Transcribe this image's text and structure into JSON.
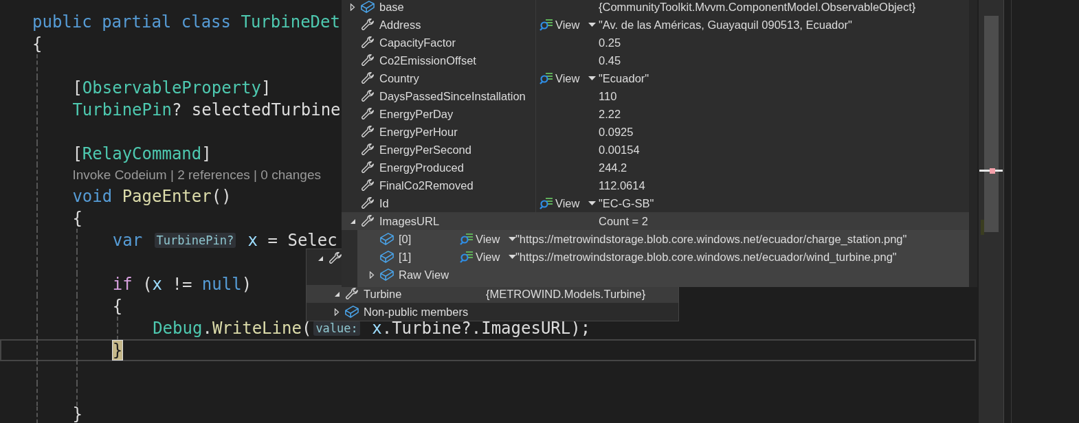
{
  "editor": {
    "lines": [
      {
        "kind": "code",
        "current": false,
        "tokens": [
          {
            "text": "public partial class ",
            "kind": "keyword"
          },
          {
            "text": "TurbineDet",
            "kind": "type"
          }
        ]
      },
      {
        "kind": "code",
        "current": false,
        "tokens": [
          {
            "text": "{",
            "kind": "plain"
          }
        ],
        "children": [
          {
            "kind": "blank",
            "current": false
          },
          {
            "kind": "code",
            "current": false,
            "tokens": [
              {
                "text": "[",
                "kind": "plain"
              },
              {
                "text": "ObservableProperty",
                "kind": "type"
              },
              {
                "text": "]",
                "kind": "plain"
              }
            ]
          },
          {
            "kind": "code",
            "current": false,
            "tokens": [
              {
                "text": "TurbinePin",
                "kind": "type"
              },
              {
                "text": "? selectedTurbine",
                "kind": "plain"
              }
            ]
          },
          {
            "kind": "blank",
            "current": false
          },
          {
            "kind": "code",
            "current": false,
            "tokens": [
              {
                "text": "[",
                "kind": "plain"
              },
              {
                "text": "RelayCommand",
                "kind": "type"
              },
              {
                "text": "]",
                "kind": "plain"
              }
            ]
          },
          {
            "kind": "codelens",
            "current": false,
            "text": "Invoke Codeium | 2 references | 0 changes"
          },
          {
            "kind": "code",
            "current": false,
            "tokens": [
              {
                "text": "void ",
                "kind": "keyword"
              },
              {
                "text": "PageEnter",
                "kind": "method"
              },
              {
                "text": "()",
                "kind": "plain"
              }
            ]
          },
          {
            "kind": "code",
            "current": false,
            "tokens": [
              {
                "text": "{",
                "kind": "plain"
              }
            ],
            "children": [
              {
                "kind": "code",
                "current": false,
                "tokens": [
                  {
                    "text": "var ",
                    "kind": "keyword"
                  },
                  {
                    "text": "TurbinePin?",
                    "kind": "hint"
                  },
                  {
                    "text": " x",
                    "kind": "variable"
                  },
                  {
                    "text": " = Selec",
                    "kind": "plain"
                  }
                ]
              },
              {
                "kind": "blank",
                "current": false
              },
              {
                "kind": "code",
                "current": false,
                "tokens": [
                  {
                    "text": "if",
                    "kind": "control"
                  },
                  {
                    "text": " (",
                    "kind": "plain"
                  },
                  {
                    "text": "x",
                    "kind": "variable"
                  },
                  {
                    "text": " != ",
                    "kind": "plain"
                  },
                  {
                    "text": "null",
                    "kind": "keyword"
                  },
                  {
                    "text": ")",
                    "kind": "plain"
                  }
                ]
              },
              {
                "kind": "code",
                "current": false,
                "tokens": [
                  {
                    "text": "{",
                    "kind": "plain"
                  }
                ],
                "children": [
                  {
                    "kind": "code",
                    "current": false,
                    "tokens": [
                      {
                        "text": "Debug",
                        "kind": "type"
                      },
                      {
                        "text": ".",
                        "kind": "plain"
                      },
                      {
                        "text": "WriteLine",
                        "kind": "method"
                      },
                      {
                        "text": "(",
                        "kind": "plain"
                      },
                      {
                        "text": "value:",
                        "kind": "hint"
                      },
                      {
                        "text": " x",
                        "kind": "variable"
                      },
                      {
                        "text": ".Turbine?.ImagesURL);",
                        "kind": "plain"
                      }
                    ]
                  }
                ]
              },
              {
                "kind": "code",
                "current": true,
                "tokens": [
                  {
                    "text": "}",
                    "kind": "brace_match"
                  }
                ]
              },
              {
                "kind": "blank",
                "current": false
              },
              {
                "kind": "blank",
                "current": false
              }
            ]
          },
          {
            "kind": "code",
            "current": false,
            "tokens": [
              {
                "text": "}",
                "kind": "plain"
              }
            ]
          }
        ]
      }
    ]
  },
  "datatips": [
    {
      "rows": [
        {
          "name": "base",
          "kind": "object",
          "expanded": false,
          "selected": false,
          "value": "{CommunityToolkit.Mvvm.ComponentModel.ObservableObject}"
        },
        {
          "name": "Address",
          "kind": "property",
          "selected": false,
          "view": "View",
          "value": "\"Av. de las Américas, Guayaquil 090513, Ecuador\""
        },
        {
          "name": "CapacityFactor",
          "kind": "property",
          "selected": false,
          "value": "0.25"
        },
        {
          "name": "Co2EmissionOffset",
          "kind": "property",
          "selected": false,
          "value": "0.45"
        },
        {
          "name": "Country",
          "kind": "property",
          "selected": false,
          "view": "View",
          "value": "\"Ecuador\""
        },
        {
          "name": "DaysPassedSinceInstallation",
          "kind": "property",
          "selected": false,
          "value": "110"
        },
        {
          "name": "EnergyPerDay",
          "kind": "property",
          "selected": false,
          "value": "2.22"
        },
        {
          "name": "EnergyPerHour",
          "kind": "property",
          "selected": false,
          "value": "0.0925"
        },
        {
          "name": "EnergyPerSecond",
          "kind": "property",
          "selected": false,
          "value": "0.00154"
        },
        {
          "name": "EnergyProduced",
          "kind": "property",
          "selected": false,
          "value": "244.2"
        },
        {
          "name": "FinalCo2Removed",
          "kind": "property",
          "selected": false,
          "value": "112.0614"
        },
        {
          "name": "Id",
          "kind": "property",
          "selected": false,
          "view": "View",
          "value": "\"EC-G-SB\""
        },
        {
          "name": "ImagesURL",
          "kind": "property",
          "expanded": true,
          "selected": true,
          "value": "Count = 2",
          "children": [
            {
              "name": "[0]",
              "kind": "object",
              "selected": false,
              "view": "View",
              "value": "\"https://metrowindstorage.blob.core.windows.net/ecuador/charge_station.png\""
            },
            {
              "name": "[1]",
              "kind": "object",
              "selected": false,
              "view": "View",
              "value": "\"https://metrowindstorage.blob.core.windows.net/ecuador/wind_turbine.png\""
            },
            {
              "name": "Raw View",
              "kind": "object",
              "expanded": false,
              "selected": false
            }
          ]
        }
      ]
    },
    {
      "rows": [
        {
          "kind": "property",
          "expanded": true,
          "selected": false,
          "children": [
            {
              "name": "Turbine",
              "kind": "property",
              "expanded": true,
              "selected": true,
              "value": "{METROWIND.Models.Turbine}"
            },
            {
              "name": "Non-public members",
              "kind": "object",
              "expanded": false,
              "selected": false
            }
          ]
        }
      ]
    }
  ]
}
